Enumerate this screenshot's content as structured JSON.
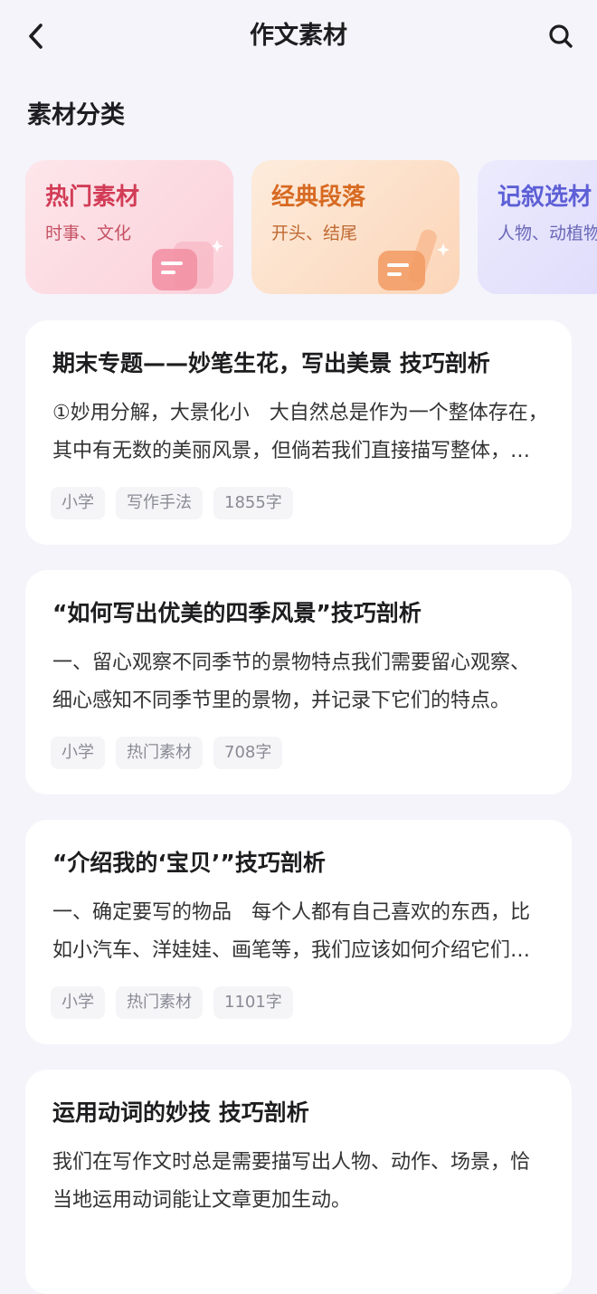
{
  "header": {
    "title": "作文素材",
    "back_icon": "chevron-left-icon",
    "search_icon": "search-icon"
  },
  "categories": {
    "section_title": "素材分类",
    "items": [
      {
        "title": "热门素材",
        "subtitle": "时事、文化",
        "color": "#d23c56"
      },
      {
        "title": "经典段落",
        "subtitle": "开头、结尾",
        "color": "#d76a22"
      },
      {
        "title": "记叙选材",
        "subtitle": "人物、动植物",
        "color": "#5d5fd6"
      }
    ]
  },
  "articles": [
    {
      "title": "期末专题——妙笔生花，写出美景 技巧剖析",
      "excerpt": "①妙用分解，大景化小　大自然总是作为一个整体存在，其中有无数的美丽风景，但倘若我们直接描写整体，往往会显得空泛。",
      "tags": [
        "小学",
        "写作手法",
        "1855字"
      ]
    },
    {
      "title": "“如何写出优美的四季风景”技巧剖析",
      "excerpt": "一、留心观察不同季节的景物特点我们需要留心观察、细心感知不同季节里的景物，并记录下它们的特点。",
      "tags": [
        "小学",
        "热门素材",
        "708字"
      ]
    },
    {
      "title": "“介绍我的‘宝贝’”技巧剖析",
      "excerpt": "一、确定要写的物品　每个人都有自己喜欢的东西，比如小汽车、洋娃娃、画笔等，我们应该如何介绍它们呢？",
      "tags": [
        "小学",
        "热门素材",
        "1101字"
      ]
    },
    {
      "title": "运用动词的妙技 技巧剖析",
      "excerpt": "我们在写作文时总是需要描写出人物、动作、场景，恰当地运用动词能让文章更加生动。",
      "tags": []
    }
  ]
}
